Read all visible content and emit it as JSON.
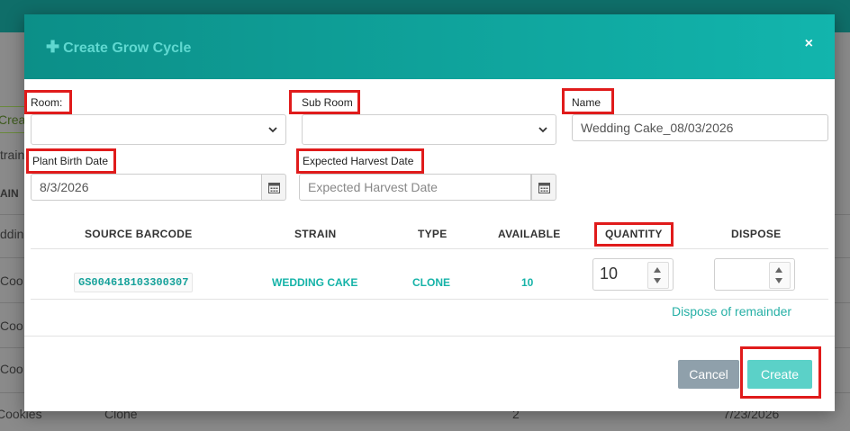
{
  "background": {
    "tab_fragment": "Crea",
    "col_fragment": "train",
    "col_header_fragment": "AIN",
    "rows": [
      "ddin",
      "Coo",
      "Coo",
      "Coo",
      "Cookies"
    ],
    "last_row": {
      "type": "Clone",
      "count": "2",
      "date": "7/23/2026"
    }
  },
  "modal": {
    "title": "Create Grow Cycle",
    "close": "×"
  },
  "form": {
    "room_label": "Room:",
    "subroom_label": "Sub Room",
    "name_label": "Name",
    "name_value": "Wedding Cake_08/03/2026",
    "birth_label": "Plant Birth Date",
    "birth_value": "8/3/2026",
    "harvest_label": "Expected Harvest Date",
    "harvest_placeholder": "Expected Harvest Date"
  },
  "table": {
    "headers": [
      "SOURCE BARCODE",
      "STRAIN",
      "TYPE",
      "AVAILABLE",
      "QUANTITY",
      "DISPOSE"
    ],
    "row": {
      "barcode": "GS004618103300307",
      "strain": "WEDDING CAKE",
      "type": "CLONE",
      "available": "10",
      "quantity": "10",
      "dispose": ""
    },
    "dispose_link": "Dispose of remainder"
  },
  "buttons": {
    "cancel": "Cancel",
    "create": "Create"
  },
  "colors": {
    "accent": "#12b5ad",
    "highlight": "#e01b1b"
  }
}
